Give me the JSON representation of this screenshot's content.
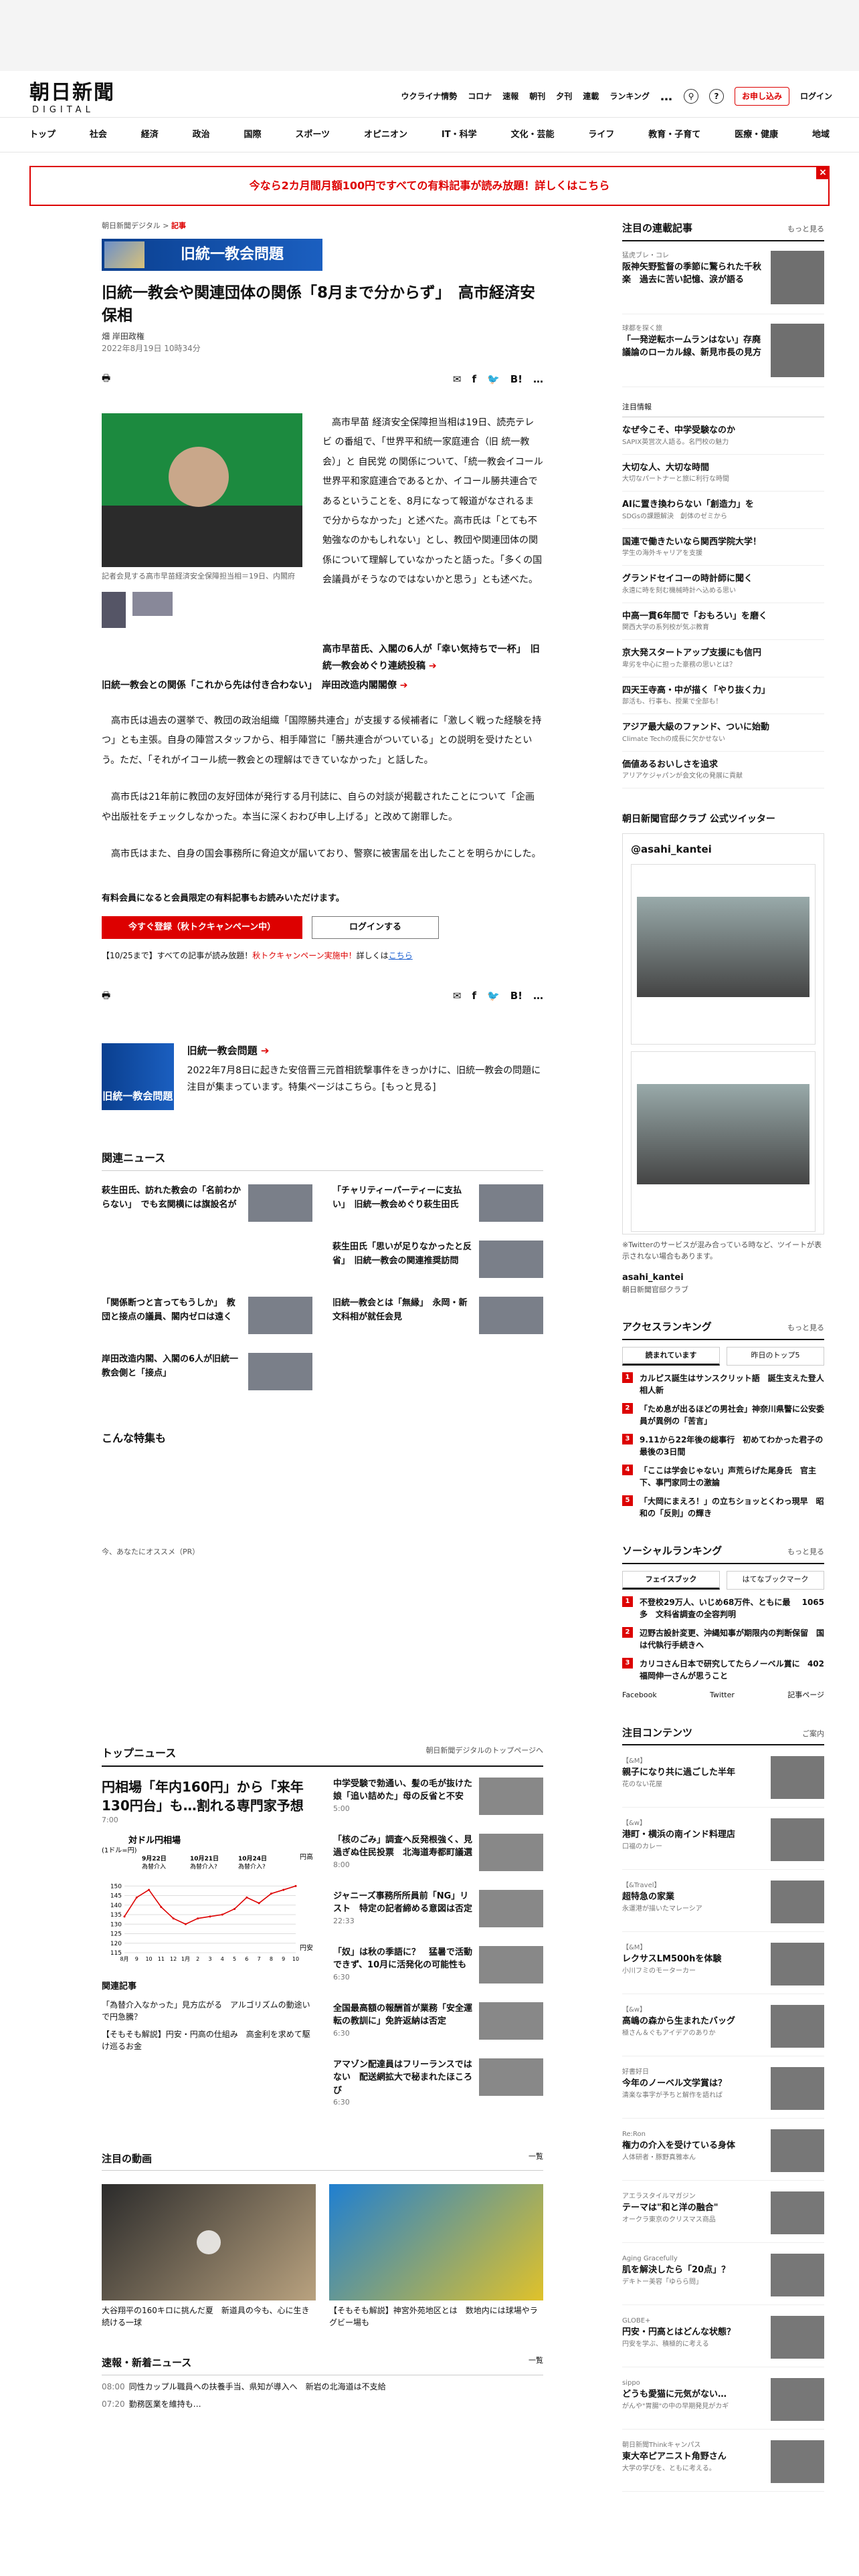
{
  "header": {
    "logo_jp": "朝日新聞",
    "logo_en": "DIGITAL",
    "links": [
      "ウクライナ情勢",
      "コロナ",
      "速報",
      "朝刊",
      "夕刊",
      "連載",
      "ランキング"
    ],
    "more": "…",
    "subscribe": "お申し込み",
    "login": "ログイン"
  },
  "gnav": [
    "トップ",
    "社会",
    "経済",
    "政治",
    "国際",
    "スポーツ",
    "オピニオン",
    "IT・科学",
    "文化・芸能",
    "ライフ",
    "教育・子育て",
    "医療・健康",
    "地域"
  ],
  "promo": "今なら2カ月間月額100円ですべての有料記事が読み放題！詳しくはこちら",
  "article": {
    "breadcrumb_home": "朝日新聞デジタル",
    "breadcrumb_sep": ">",
    "breadcrumb_section": "記事",
    "series_banner": "旧統一教会問題",
    "title": "旧統一教会や関連団体の関係「8月まで分からず」　高市経済安保相",
    "byline": "畑 岸田政権",
    "date": "2022年8月19日 10時34分",
    "share_list": "list",
    "photo_caption": "記者会見する高市早苗経済安全保障担当相＝19日、内閣府",
    "lead": "高市早苗 経済安全保障担当相は19日、読売テレビ の番組で、「世界平和統一家庭連合（旧 統一教会）」と 自民党 の関係について、「統一教会イコール世界平和家庭連合であるとか、イコール勝共連合であるということを、8月になって報道がなされるまで分からなかった」と述べた。高市氏は「とても不勉強なのかもしれない」とし、教団や関連団体の関係について理解していなかったと語った。「多くの国会議員がそうなのではないかと思う」とも述べた。",
    "rel_link_1": "高市早苗氏、入閣の6人が「幸い気持ちで一杯」　旧統一教会めぐり連続投稿",
    "rel_link_2": "旧統一教会との関係「これから先は付き合わない」　岸田改造内閣閣僚",
    "para1": "高市氏は過去の選挙で、教団の政治組織「国際勝共連合」が支援する候補者に「激しく戦った経験を持つ」とも主張。自身の陣営スタッフから、相手陣営に「勝共連合がついている」との説明を受けたという。ただ、「それがイコール統一教会との理解はできていなかった」と話した。",
    "para2": "高市氏は21年前に教団の友好団体が発行する月刊誌に、自らの対談が掲載されたことについて「企画や出版社をチェックしなかった。本当に深くおわび申し上げる」と改めて謝罪した。",
    "para3": "高市氏はまた、自身の国会事務所に脅迫文が届いており、警察に被害届を出したことを明らかにした。",
    "paywall_heading": "有料会員になると会員限定の有料記事もお読みいただけます。",
    "register_btn": "今すぐ登録（秋トクキャンペーン中）",
    "login_btn": "ログインする",
    "note_prefix": "【10/25まで】すべての記事が読み放題！",
    "note_red": "秋トクキャンペーン実施中！",
    "note_suffix": "詳しくは",
    "note_link": "こちら"
  },
  "feature": {
    "img_label": "旧統一教会問題",
    "title": "旧統一教会問題",
    "body": "2022年7月8日に起きた安倍晋三元首相銃撃事件をきっかけに、旧統一教会の問題に注目が集まっています。特集ページはこちら。[もっと見る]"
  },
  "related": {
    "heading": "関連ニュース",
    "items": [
      "萩生田氏、訪れた教会の「名前わからない」　でも玄関横には旗設名が",
      "「チャリティーパーティーに支払い」　旧統一教会めぐり萩生田氏",
      "",
      "萩生田氏「思いが足りなかったと反省」　旧統一教会の関連推奨訪問",
      "「関係断つと言ってもうしか」　教団と接点の議員、閣内ゼロは遠く",
      "旧統一教会とは「無縁」　永岡・新文科相が就任会見",
      "岸田改造内閣、入閣の6人が旧統一教会側と「接点」"
    ]
  },
  "special": {
    "heading": "こんな特集も",
    "pr": "今、あなたにオススメ（PR）"
  },
  "top_news": {
    "heading": "トップニュース",
    "link": "朝日新聞デジタルのトップページへ",
    "main_title": "円相場「年内160円」から「来年130円台」も…割れる専門家予想",
    "main_time": "7:00",
    "related_heading": "関連記事",
    "related": [
      "「為替介入なかった」見方広がる　アルゴリズムの動途いで円急騰？",
      "【そもそも解説】円安・円高の仕組み　高金利を求めて駆け巡るお金"
    ],
    "items": [
      {
        "title": "中学受験で勃通い、髪の毛が抜けた娘「追い詰めた」母の反省と不安",
        "time": "5:00"
      },
      {
        "title": "「核のごみ」調査へ反発根強く、見過ぎぬ住民投票　北海道寿都町議選",
        "time": "8:00"
      },
      {
        "title": "ジャニーズ事務所所員前「NG」リスト　特定の記者締める意図は否定",
        "time": "22:33"
      },
      {
        "title": "「奴」は秋の季語に？　猛暑で活動できず、10月に活発化の可能性も",
        "time": "6:30"
      },
      {
        "title": "全国最高額の報酬首が業務「安全運転の教訓に」免許返納は否定",
        "time": "6:30"
      },
      {
        "title": "アマゾン配達員はフリーランスではない　配送網拡大で秘まれたほころび",
        "time": "6:30"
      }
    ]
  },
  "videos": {
    "heading": "注目の動画",
    "more": "一覧",
    "items": [
      "大谷翔平の160キロに挑んだ夏　新道具の今も、心に生き続ける一球",
      "【そもそも解説】神宮外苑地区とは　数地内には球場やラグビー場も"
    ]
  },
  "breaking": {
    "heading": "速報・新着ニュース",
    "more": "一覧",
    "items": [
      {
        "time": "08:00",
        "text": "同性カップル職員への扶養手当、県知が導入へ　新岩の北海道は不支給"
      },
      {
        "time": "07:20",
        "text": "勤務医業を維持も…"
      }
    ]
  },
  "sidebar": {
    "serial_heading": "注目の連載記事",
    "more": "もっと見る",
    "serials": [
      {
        "cat": "猛虎ブレ・コレ",
        "title": "阪神矢野監督の季節に驚られた千秋楽　過去に苦い記憶、涙が語る"
      },
      {
        "cat": "球都を探く旅",
        "title": "「一発逆転ホームランはない」存廃議論のローカル線、新見市長の見方"
      }
    ],
    "list_heading": "注目情報",
    "list": [
      {
        "title": "なぜ今こそ、中学受験なのか",
        "sub": "SAPIX英営次人語る。名門校の魅力"
      },
      {
        "title": "大切な人、大切な時間",
        "sub": "大切なパートナーと旅に利行な時間"
      },
      {
        "title": "AIに置き換わらない「創造力」を",
        "sub": "SDGsの課題解決　創体のゼミから"
      },
      {
        "title": "国連で働きたいなら関西学院大学！",
        "sub": "学生の海外キャリアを支援"
      },
      {
        "title": "グランドセイコーの時計師に聞く",
        "sub": "永遠に時を刻む機械時計へ込める思い"
      },
      {
        "title": "中高一貫6年間で「おもろい」を磨く",
        "sub": "関西大学の系列校が気ぶ教育"
      },
      {
        "title": "京大発スタートアップ支援にも信円",
        "sub": "卑劣を中心に担った豪務の思いとは？"
      },
      {
        "title": "四天王寺高・中が描く「やり抜く力」",
        "sub": "部活も、行事も、授業で全部も！"
      },
      {
        "title": "アジア最大級のファンド、ついに始動",
        "sub": "Climate Techの成長に欠かせない"
      },
      {
        "title": "価値あるおいしさを追求",
        "sub": "アリアケジャパンが会文化の発展に貢献"
      }
    ],
    "twitter_heading": "朝日新聞官邸クラブ 公式ツイッター",
    "twitter_handle": "@asahi_kantei",
    "twitter_note": "※Twitterのサービスが混み合っている時など、ツイートが表示されない場合もあります。",
    "twitter_acct": "asahi_kantei",
    "twitter_acct_sub": "朝日新聞官邸クラブ",
    "ranking_heading": "アクセスランキング",
    "ranking_tabs": [
      "読まれています",
      "昨日のトップ5"
    ],
    "ranking": [
      "カルピス誕生はサンスクリット語　誕生支えた登人相人新",
      "「ため息が出るほどの男社会」神奈川県警に公安委員が異例の「苦言」",
      "9.11から22年後の総事行　初めてわかった君子の最後の3日間",
      "「ここは学会じゃない」声荒らげた尾身氏　官主下、事門家同士の激論",
      "「大岡にまえろ！」の立ちショッとくわっ現早　昭和の「反則」の輝き"
    ],
    "social_heading": "ソーシャルランキング",
    "social_tabs": [
      "フェイスブック",
      "はてなブックマーク"
    ],
    "social": [
      "不登校29万人、いじめ68万件、ともに最多　文科省調査の全容判明",
      "辺野古設計変更、沖縄知事が期限内の判断保留　国は代執行手続きへ",
      "カリコさん日本で研究してたらノーベル賞に福岡伸一さんが思うこと"
    ],
    "social_counts": [
      "1065",
      "",
      "402"
    ],
    "social_fb": "Facebook",
    "social_tw": "Twitter",
    "social_more": "記事ページ",
    "content_heading": "注目コンテンツ",
    "content_more": "ご案内",
    "contents": [
      {
        "cat": "【&M】",
        "title": "親子になり共に過ごした半年",
        "sub": "花のない花屋"
      },
      {
        "cat": "【&w】",
        "title": "港町・横浜の南インド料理店",
        "sub": "口福のカレー"
      },
      {
        "cat": "【&Travel】",
        "title": "超特急の家業",
        "sub": "永運港が描いたマレーシア"
      },
      {
        "cat": "【&M】",
        "title": "レクサスLM500hを体験",
        "sub": "小川フミのモーターカー"
      },
      {
        "cat": "【&w】",
        "title": "高嶋の森から生まれたバッグ",
        "sub": "極さん＆ぐもアイデアのありか"
      },
      {
        "cat": "好書好日",
        "title": "今年のノーベル文学賞は？",
        "sub": "清楽な事字が予ちと解作を語れば"
      },
      {
        "cat": "Re:Ron",
        "title": "権力の介入を受けている身体",
        "sub": "人体研者・豚野真雅本ん"
      },
      {
        "cat": "アエラスタイルマガジン",
        "title": "テーマは\"和と洋の融合\"",
        "sub": "オークラ東京のクリスマス商品"
      },
      {
        "cat": "Aging Gracefully",
        "title": "肌を解決したら「20点」？",
        "sub": "デキトー美容「ゆらら問」"
      },
      {
        "cat": "GLOBE+",
        "title": "円安・円高とはどんな状態？",
        "sub": "円安を学ぶ、積極的に考える"
      },
      {
        "cat": "sippo",
        "title": "どうも愛猫に元気がない…",
        "sub": "がんや\"胃腸\"の中の早期発見がカギ"
      },
      {
        "cat": "朝日新聞Thinkキャンパス",
        "title": "東大卒ピアニスト角野さん",
        "sub": "大学の学びを、ともに考える。"
      }
    ]
  },
  "chart_data": {
    "type": "line",
    "title": "対ドル円相場",
    "unit": "(1ドル=円)",
    "annotations": [
      {
        "date": "9月22日",
        "label": "為替介入"
      },
      {
        "date": "10月21日",
        "label": "為替介入?"
      },
      {
        "date": "10月24日",
        "label": "為替介入?"
      }
    ],
    "right_labels": [
      "円高",
      "円安"
    ],
    "x_ticks": [
      "8月",
      "9",
      "10",
      "11",
      "12",
      "1月",
      "2",
      "3",
      "4",
      "5",
      "6",
      "7",
      "8",
      "9",
      "10"
    ],
    "ylim": [
      115,
      155
    ],
    "y_ticks": [
      115,
      120,
      125,
      130,
      135,
      140,
      145,
      150
    ],
    "x": [
      0,
      1,
      2,
      3,
      4,
      5,
      6,
      7,
      8,
      9,
      10,
      11,
      12,
      13,
      14
    ],
    "values": [
      134,
      144,
      148,
      139,
      133,
      130,
      133,
      134,
      135,
      138,
      144,
      141,
      146,
      148,
      150
    ],
    "color": "#d00"
  }
}
